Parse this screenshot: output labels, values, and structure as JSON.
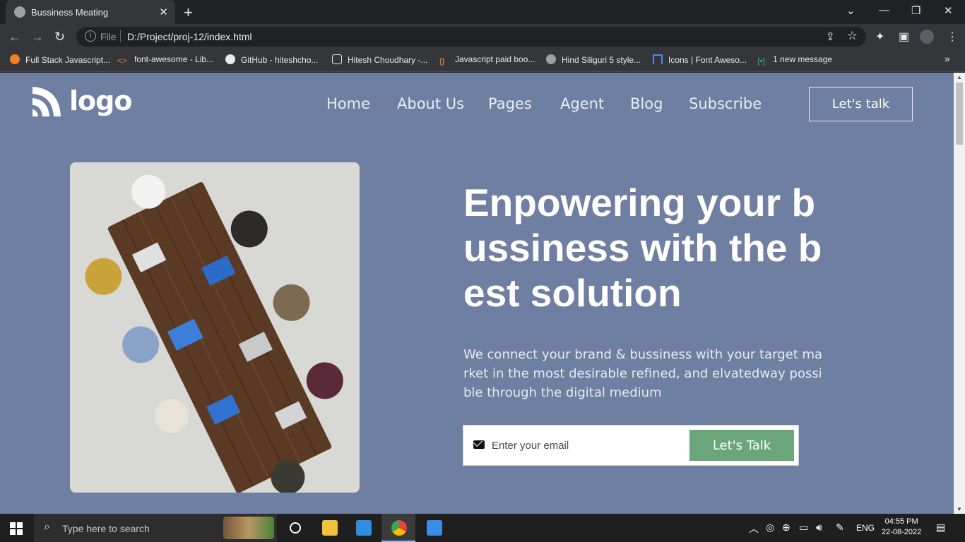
{
  "browser": {
    "tab_title": "Bussiness Meating",
    "url_scheme": "File",
    "url": "D:/Project/proj-12/index.html",
    "bookmarks": [
      {
        "label": "Full Stack Javascript...",
        "icon": "orange-circle-icon"
      },
      {
        "label": "font-awesome - Lib...",
        "icon": "code-brackets-icon"
      },
      {
        "label": "GitHub - hiteshcho...",
        "icon": "github-icon"
      },
      {
        "label": "Hitesh Choudhary -...",
        "icon": "page-icon"
      },
      {
        "label": "Javascript paid boo...",
        "icon": "curly-braces-icon"
      },
      {
        "label": "Hind Siliguri 5 style...",
        "icon": "globe-icon"
      },
      {
        "label": "Icons | Font Aweso...",
        "icon": "flag-icon"
      },
      {
        "label": "1 new message",
        "icon": "chat-icon"
      }
    ],
    "more_bookmarks": "»"
  },
  "site": {
    "logo_text": "logo",
    "nav": [
      "Home",
      "About Us",
      "Pages",
      "Agent",
      "Blog",
      "Subscribe"
    ],
    "cta_top": "Let's talk",
    "headline": "Enpowering your bussiness with the best solution",
    "subtext": "We connect your brand & bussiness with your target market in the most desirable refined, and elvatedway possible through the digital medium",
    "email_placeholder": "Enter your email",
    "email_button": "Let's Talk",
    "colors": {
      "background": "#6f7fa1",
      "button": "#6aa57b"
    }
  },
  "taskbar": {
    "search_placeholder": "Type here to search",
    "language": "ENG",
    "time": "04:55 PM",
    "date": "22-08-2022"
  }
}
